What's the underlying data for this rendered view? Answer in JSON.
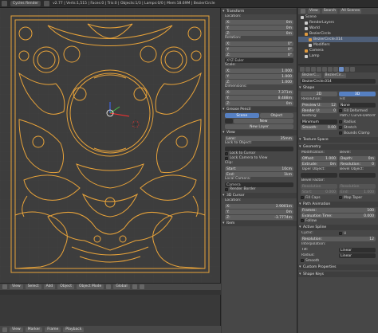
{
  "topbar": {
    "engine": "Cycles Render",
    "stats": "v2.77 | Verts:1,515 | Faces:0 | Tris:0 | Objects:1/3 | Lamps:0/0 | Mem:18.69M | BezierCircle"
  },
  "viewport": {
    "header_items": [
      "View",
      "Select",
      "Add",
      "Object",
      "Object Mode",
      "Global"
    ],
    "colors": {
      "curve": "#e8a33a",
      "background": "#3d3d3d",
      "grid": "#444444"
    }
  },
  "timeline": {
    "header_items": [
      "View",
      "Marker",
      "Frame",
      "Playback"
    ]
  },
  "npanel": {
    "transform": {
      "title": "Transform",
      "location_label": "Location:",
      "location": [
        [
          "X:",
          "0m"
        ],
        [
          "Y:",
          "0m"
        ],
        [
          "Z:",
          "0m"
        ]
      ],
      "rotation_label": "Rotation:",
      "rotation": [
        [
          "X:",
          "0°"
        ],
        [
          "Y:",
          "0°"
        ],
        [
          "Z:",
          "0°"
        ]
      ],
      "rotation_mode": "XYZ Euler",
      "scale_label": "Scale:",
      "scale": [
        [
          "X:",
          "1.000"
        ],
        [
          "Y:",
          "1.000"
        ],
        [
          "Z:",
          "1.000"
        ]
      ],
      "dimensions_label": "Dimensions:",
      "dimensions": [
        [
          "X:",
          "7.371m"
        ],
        [
          "Y:",
          "8.488m"
        ],
        [
          "Z:",
          "0m"
        ]
      ]
    },
    "grease_pencil": {
      "title": "Grease Pencil",
      "scene": "Scene",
      "object": "Object",
      "new": "New",
      "new_layer": "New Layer"
    },
    "view": {
      "title": "View",
      "lens_label": "Lens:",
      "lens_value": "35mm",
      "lock_object_label": "Lock to Object:",
      "lock_cursor": "Lock to Cursor",
      "lock_camera": "Lock Camera to View",
      "clip_label": "Clip:",
      "clip_start": [
        "Start:",
        "10cm"
      ],
      "clip_end": [
        "End:",
        "1km"
      ],
      "local_camera_label": "Local Camera:",
      "local_camera_value": "Camera",
      "render_border": "Render Border"
    },
    "cursor": {
      "title": "3D Cursor",
      "location_label": "Location:",
      "location": [
        [
          "X:",
          "2.9001m"
        ],
        [
          "Y:",
          "0m"
        ],
        [
          "Z:",
          "-3.7774m"
        ]
      ]
    },
    "item": {
      "title": "Item"
    }
  },
  "outliner": {
    "header": [
      "View",
      "Search",
      "All Scenes"
    ],
    "rows": [
      {
        "label": "Scene",
        "indent": 0,
        "icon": "white"
      },
      {
        "label": "RenderLayers",
        "indent": 1,
        "icon": "white"
      },
      {
        "label": "World",
        "indent": 1,
        "icon": "white"
      },
      {
        "label": "BezierCircle",
        "indent": 1,
        "icon": "orange"
      },
      {
        "label": "BezierCircle.014",
        "indent": 2,
        "icon": "orange"
      },
      {
        "label": "Modifiers",
        "indent": 2,
        "icon": "white"
      },
      {
        "label": "Camera",
        "indent": 1,
        "icon": "orange"
      },
      {
        "label": "Lamp",
        "indent": 1,
        "icon": "white"
      }
    ]
  },
  "properties": {
    "path": [
      "BezierC...",
      "BezierCir..."
    ],
    "datablock": "BezierCircle.014",
    "shape": {
      "title": "Shape",
      "mode_2d": "2D",
      "mode_3d": "3D",
      "resolution_label": "Resolution:",
      "preview_u": [
        "Preview U:",
        "12"
      ],
      "render_u": [
        "Render U:",
        "0"
      ],
      "fill_label": "Fill:",
      "fill_value": "None",
      "fill_deformed": "Fill Deformed",
      "twisting_label": "Twisting:",
      "twisting_value": "Minimum",
      "smooth": [
        "Smooth:",
        "0.00"
      ],
      "path_curve_label": "Path / Curve-Deform:",
      "radius": "Radius",
      "stretch": "Stretch",
      "bounds_clamp": "Bounds Clamp"
    },
    "texture_space": {
      "title": "Texture Space"
    },
    "geometry": {
      "title": "Geometry",
      "modification_label": "Modification:",
      "offset": [
        "Offset:",
        "1.000"
      ],
      "extrude": [
        "Extrude:",
        "0m"
      ],
      "taper_object_label": "Taper Object:",
      "bevel_label": "Bevel:",
      "depth": [
        "Depth:",
        "0m"
      ],
      "resolution": [
        "Resolution:",
        "0"
      ],
      "bevel_object_label": "Bevel Object:",
      "bevel_factor_label": "Bevel Factor:",
      "resolution_mode": "Resolution",
      "start": [
        "Start:",
        "0.000"
      ],
      "end": [
        "End:",
        "1.000"
      ],
      "fill_caps": "Fill Caps",
      "map_taper": "Map Taper"
    },
    "path_animation": {
      "title": "Path Animation",
      "frames": [
        "Frames:",
        "100"
      ],
      "evaluation_time": [
        "Evaluation Time:",
        "0.000"
      ],
      "follow": "Follow"
    },
    "active_spline": {
      "title": "Active Spline",
      "cyclic_label": "Cyclic:",
      "cyclic_u": "U",
      "resolution": [
        "Resolution:",
        "12"
      ],
      "interpolation_label": "Interpolation:",
      "tilt_label": "Tilt:",
      "tilt_value": "Linear",
      "radius_label": "Radius:",
      "radius_value": "Linear",
      "smooth": "Smooth"
    },
    "custom_properties": {
      "title": "Custom Properties"
    },
    "shape_keys": {
      "title": "Shape Keys"
    }
  }
}
